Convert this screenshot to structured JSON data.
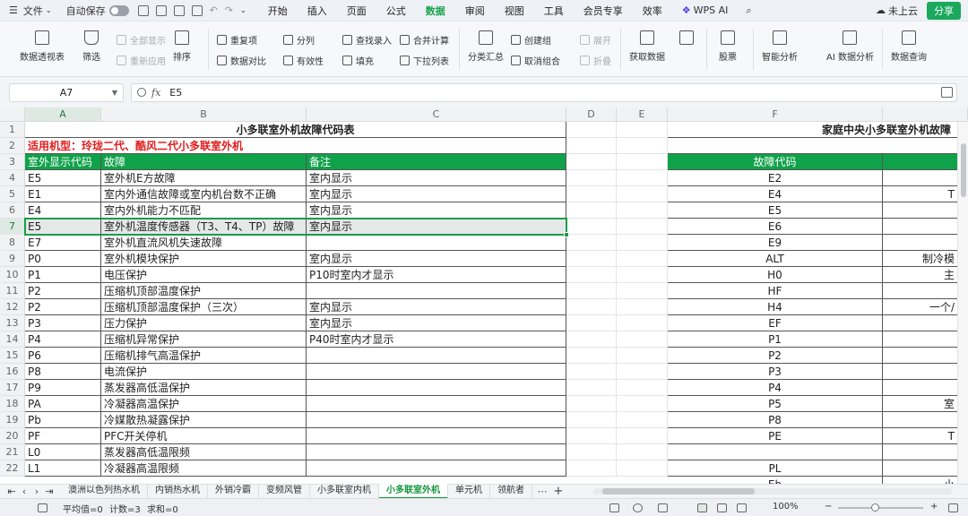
{
  "menubar": {
    "file": "文件",
    "autosave": "自动保存",
    "tabs": [
      "开始",
      "插入",
      "页面",
      "公式",
      "数据",
      "审阅",
      "视图",
      "工具",
      "会员专享",
      "效率"
    ],
    "active_tab": "数据",
    "wps_ai": "WPS AI",
    "cloud": "未上云",
    "share": "分享"
  },
  "ribbon": {
    "pivot": "数据透视表",
    "filter": "筛选",
    "show_all": "全部显示",
    "reapply": "重新应用",
    "sort": "排序",
    "duplicates": "重复项",
    "compare": "数据对比",
    "split_col": "分列",
    "validity": "有效性",
    "lookup": "查找录入",
    "fill": "填充",
    "merge_calc": "合并计算",
    "dropdown": "下拉列表",
    "subtotal": "分类汇总",
    "create_group": "创建组",
    "ungroup": "取消组合",
    "expand": "展开",
    "collapse": "折叠",
    "get_data": "获取数据",
    "stock": "股票",
    "smart_analysis": "智能分析",
    "ai_analysis": "AI 数据分析",
    "data_query": "数据查询"
  },
  "formula_bar": {
    "cell_ref": "A7",
    "fx": "fx",
    "content": "E5"
  },
  "columns": [
    "A",
    "B",
    "C",
    "D",
    "E",
    "F"
  ],
  "selected_row": "7",
  "table1": {
    "title": "小多联室外机故障代码表",
    "applies_to": "适用机型：玲珑二代、酷风二代小多联室外机",
    "headers": [
      "室外显示代码",
      "故障",
      "备注"
    ],
    "rows": [
      [
        "E5",
        "室外机E方故障",
        "室内显示"
      ],
      [
        "E1",
        "室内外通信故障或室内机台数不正确",
        "室内显示"
      ],
      [
        "E4",
        "室内外机能力不匹配",
        "室内显示"
      ],
      [
        "E5",
        "室外机温度传感器（T3、T4、TP）故障",
        "室内显示"
      ],
      [
        "E7",
        "室外机直流风机失速故障",
        ""
      ],
      [
        "P0",
        "室外机模块保护",
        "室内显示"
      ],
      [
        "P1",
        "电压保护",
        "P10时室内才显示"
      ],
      [
        "P2",
        "压缩机顶部温度保护",
        ""
      ],
      [
        "P2",
        "压缩机顶部温度保护（三次）",
        "室内显示"
      ],
      [
        "P3",
        "压力保护",
        "室内显示"
      ],
      [
        "P4",
        "压缩机异常保护",
        "P40时室内才显示"
      ],
      [
        "P6",
        "压缩机排气高温保护",
        ""
      ],
      [
        "P8",
        "电流保护",
        ""
      ],
      [
        "P9",
        "蒸发器高低温保护",
        ""
      ],
      [
        "PA",
        "冷凝器高温保护",
        ""
      ],
      [
        "Pb",
        "冷媒散热凝露保护",
        ""
      ],
      [
        "PF",
        "PFC开关停机",
        ""
      ],
      [
        "L0",
        "蒸发器高低温限频",
        ""
      ],
      [
        "L1",
        "冷凝器高温限频",
        ""
      ]
    ]
  },
  "table2": {
    "title": "家庭中央小多联室外机故障",
    "header": "故障代码",
    "codes": [
      "E2",
      "E4",
      "E5",
      "E6",
      "E9",
      "ALT",
      "H0",
      "HF",
      "H4",
      "EF",
      "P1",
      "P2",
      "P3",
      "P4",
      "P5",
      "P8",
      "PE",
      "",
      "PL",
      "Eb"
    ],
    "partial_desc": [
      "",
      "T",
      "",
      "",
      "",
      "制冷模",
      "主",
      "",
      "一个/",
      "",
      "",
      "",
      "",
      "",
      "室",
      "",
      "T",
      "",
      "",
      "一小"
    ]
  },
  "row_numbers": [
    "1",
    "2",
    "3",
    "4",
    "5",
    "6",
    "7",
    "8",
    "9",
    "10",
    "11",
    "12",
    "13",
    "14",
    "15",
    "16",
    "17",
    "18",
    "19",
    "20",
    "21",
    "22"
  ],
  "sheet_tabs": [
    "澳洲以色列热水机",
    "内销热水机",
    "外销冷霸",
    "变频风管",
    "小多联室内机",
    "小多联室外机",
    "单元机",
    "领航者"
  ],
  "active_sheet": "小多联室外机",
  "status": {
    "average": "平均值=0",
    "count": "计数=3",
    "sum": "求和=0",
    "zoom": "100%"
  },
  "colors": {
    "accent": "#10a24a",
    "alert": "#e21c1c"
  }
}
